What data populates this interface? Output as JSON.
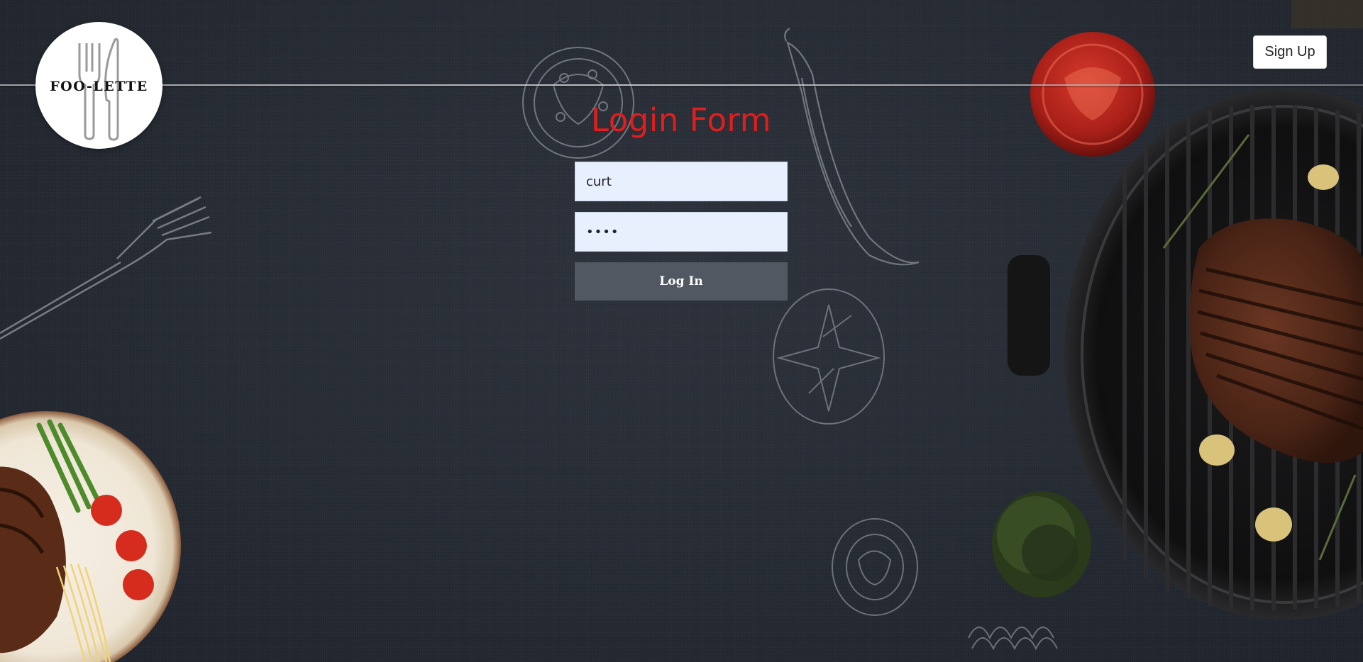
{
  "brand": {
    "name": "FOO-LETTE"
  },
  "header": {
    "signup_label": "Sign Up"
  },
  "login_form": {
    "title": "Login Form",
    "username_value": "curt",
    "password_value": "curt",
    "login_label": "Log In"
  },
  "colors": {
    "title": "#e31d1d",
    "input_bg": "#e8f0fe",
    "button_bg": "#515861",
    "page_bg": "#282c35"
  }
}
